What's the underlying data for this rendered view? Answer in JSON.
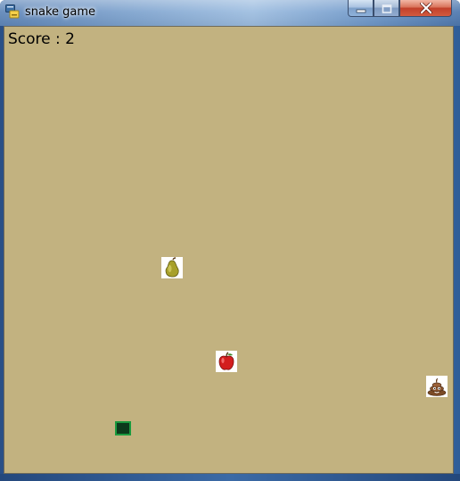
{
  "window": {
    "title": "snake game",
    "app_icon": "python-icon",
    "controls": {
      "minimize": "minimize-icon",
      "maximize": "maximize-icon",
      "close": "close-icon"
    }
  },
  "game": {
    "score_label": "Score : 2",
    "background_color": "#c2b280",
    "items": [
      {
        "kind": "pear",
        "icon": "pear-icon"
      },
      {
        "kind": "apple",
        "icon": "apple-icon"
      },
      {
        "kind": "poop",
        "icon": "poop-icon"
      }
    ],
    "snake": {
      "length": 1,
      "color": "#0c3a1c",
      "border_color": "#1a9a3e"
    }
  }
}
